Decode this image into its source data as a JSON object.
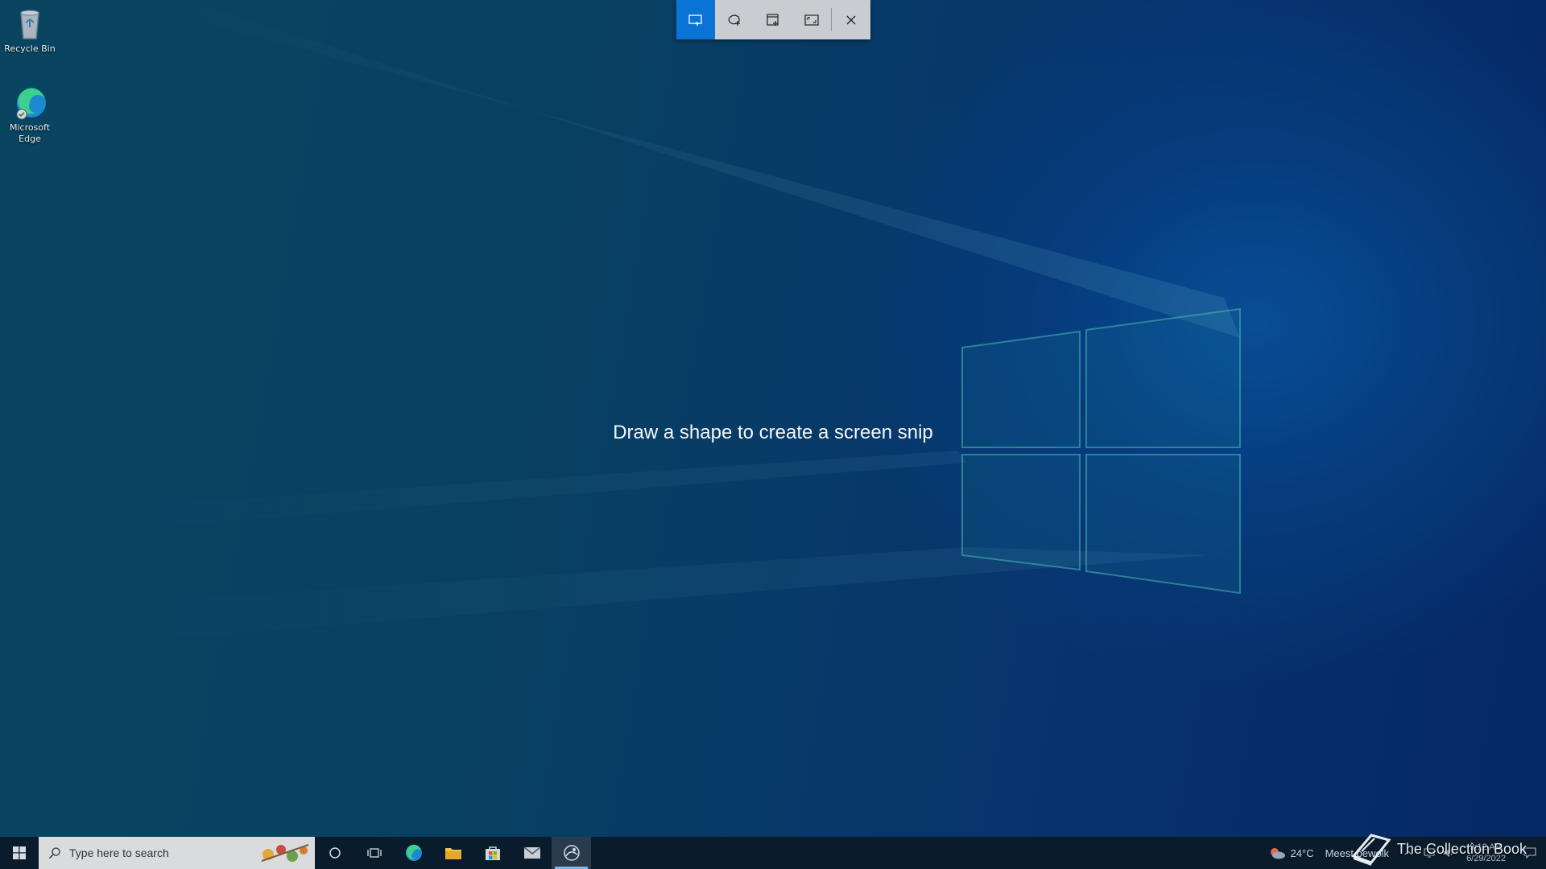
{
  "desktop": {
    "icons": [
      {
        "label": "Recycle Bin"
      },
      {
        "label": "Microsoft Edge"
      }
    ]
  },
  "snip_toolbar": {
    "buttons": [
      {
        "name": "rectangular-snip",
        "icon": "rectangle-snip-icon",
        "active": true
      },
      {
        "name": "freeform-snip",
        "icon": "freeform-snip-icon",
        "active": false
      },
      {
        "name": "window-snip",
        "icon": "window-snip-icon",
        "active": false
      },
      {
        "name": "fullscreen-snip",
        "icon": "fullscreen-snip-icon",
        "active": false
      },
      {
        "name": "close",
        "icon": "close-icon",
        "active": false
      }
    ],
    "accent": "#0a73d6"
  },
  "hint": "Draw a shape to create a screen snip",
  "taskbar": {
    "search_placeholder": "Type here to search",
    "weather": {
      "temp": "24°C",
      "text": "Meest bewolk"
    },
    "clock": {
      "time": "9:12 AM",
      "date": "6/29/2022"
    }
  },
  "watermark": "The Collection Book"
}
